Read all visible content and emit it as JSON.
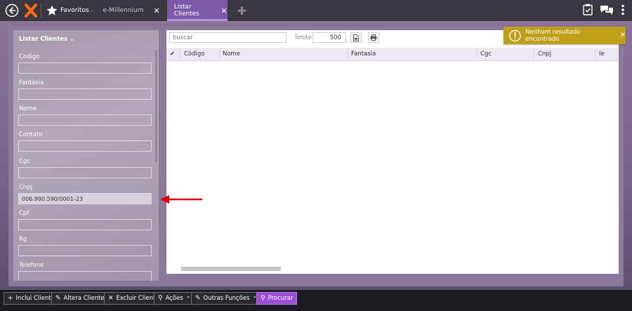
{
  "topbar": {
    "favorites_label": "Favoritos",
    "favorites_chevron": "-",
    "tab_inactive_label": "e-Millennium",
    "tab_close": "✕",
    "tab_active_label": "Listar Clientes",
    "add_tab": "✚",
    "icons": [
      "back-icon",
      "logo-icon",
      "star-icon",
      "clipboard-check-icon",
      "chat-icon",
      "more-vertical-icon"
    ]
  },
  "filter_panel": {
    "title": "Listar Clientes",
    "fields": [
      {
        "label": "Codigo",
        "value": ""
      },
      {
        "label": "Fantasia",
        "value": ""
      },
      {
        "label": "Nome",
        "value": ""
      },
      {
        "label": "Contato",
        "value": ""
      },
      {
        "label": "Cgc",
        "value": ""
      },
      {
        "label": "Cnpj",
        "value": "006.990.590/0001-23"
      },
      {
        "label": "Cpf",
        "value": ""
      },
      {
        "label": "Rg",
        "value": ""
      },
      {
        "label": "Telefone",
        "value": ""
      }
    ]
  },
  "results": {
    "search_placeholder": "buscar",
    "limit_label": "limite:",
    "limit_value": "500",
    "columns": [
      "Código",
      "Nome",
      "Fantasia",
      "Cgc",
      "Cnpj",
      "Ie"
    ]
  },
  "toast": {
    "message": "Nenhum resultado encontrado",
    "close": "✕",
    "color": "#bf9e19"
  },
  "bottom_bar": {
    "buttons": [
      {
        "label": "Inclui Cliente",
        "icon": "+"
      },
      {
        "label": "Altera Cliente",
        "icon": "✎"
      },
      {
        "label": "Excluir Cliente",
        "icon": "✕"
      },
      {
        "label": "Ações",
        "icon": "⚲"
      },
      {
        "label": "Outras Funções",
        "icon": "✎"
      },
      {
        "label": "Procurar",
        "icon": "⚲"
      }
    ],
    "chevron": "⌃"
  },
  "colors": {
    "accent": "#7b58a8",
    "primary_button": "#9b4fd6",
    "annotation_arrow": "#e00000"
  }
}
